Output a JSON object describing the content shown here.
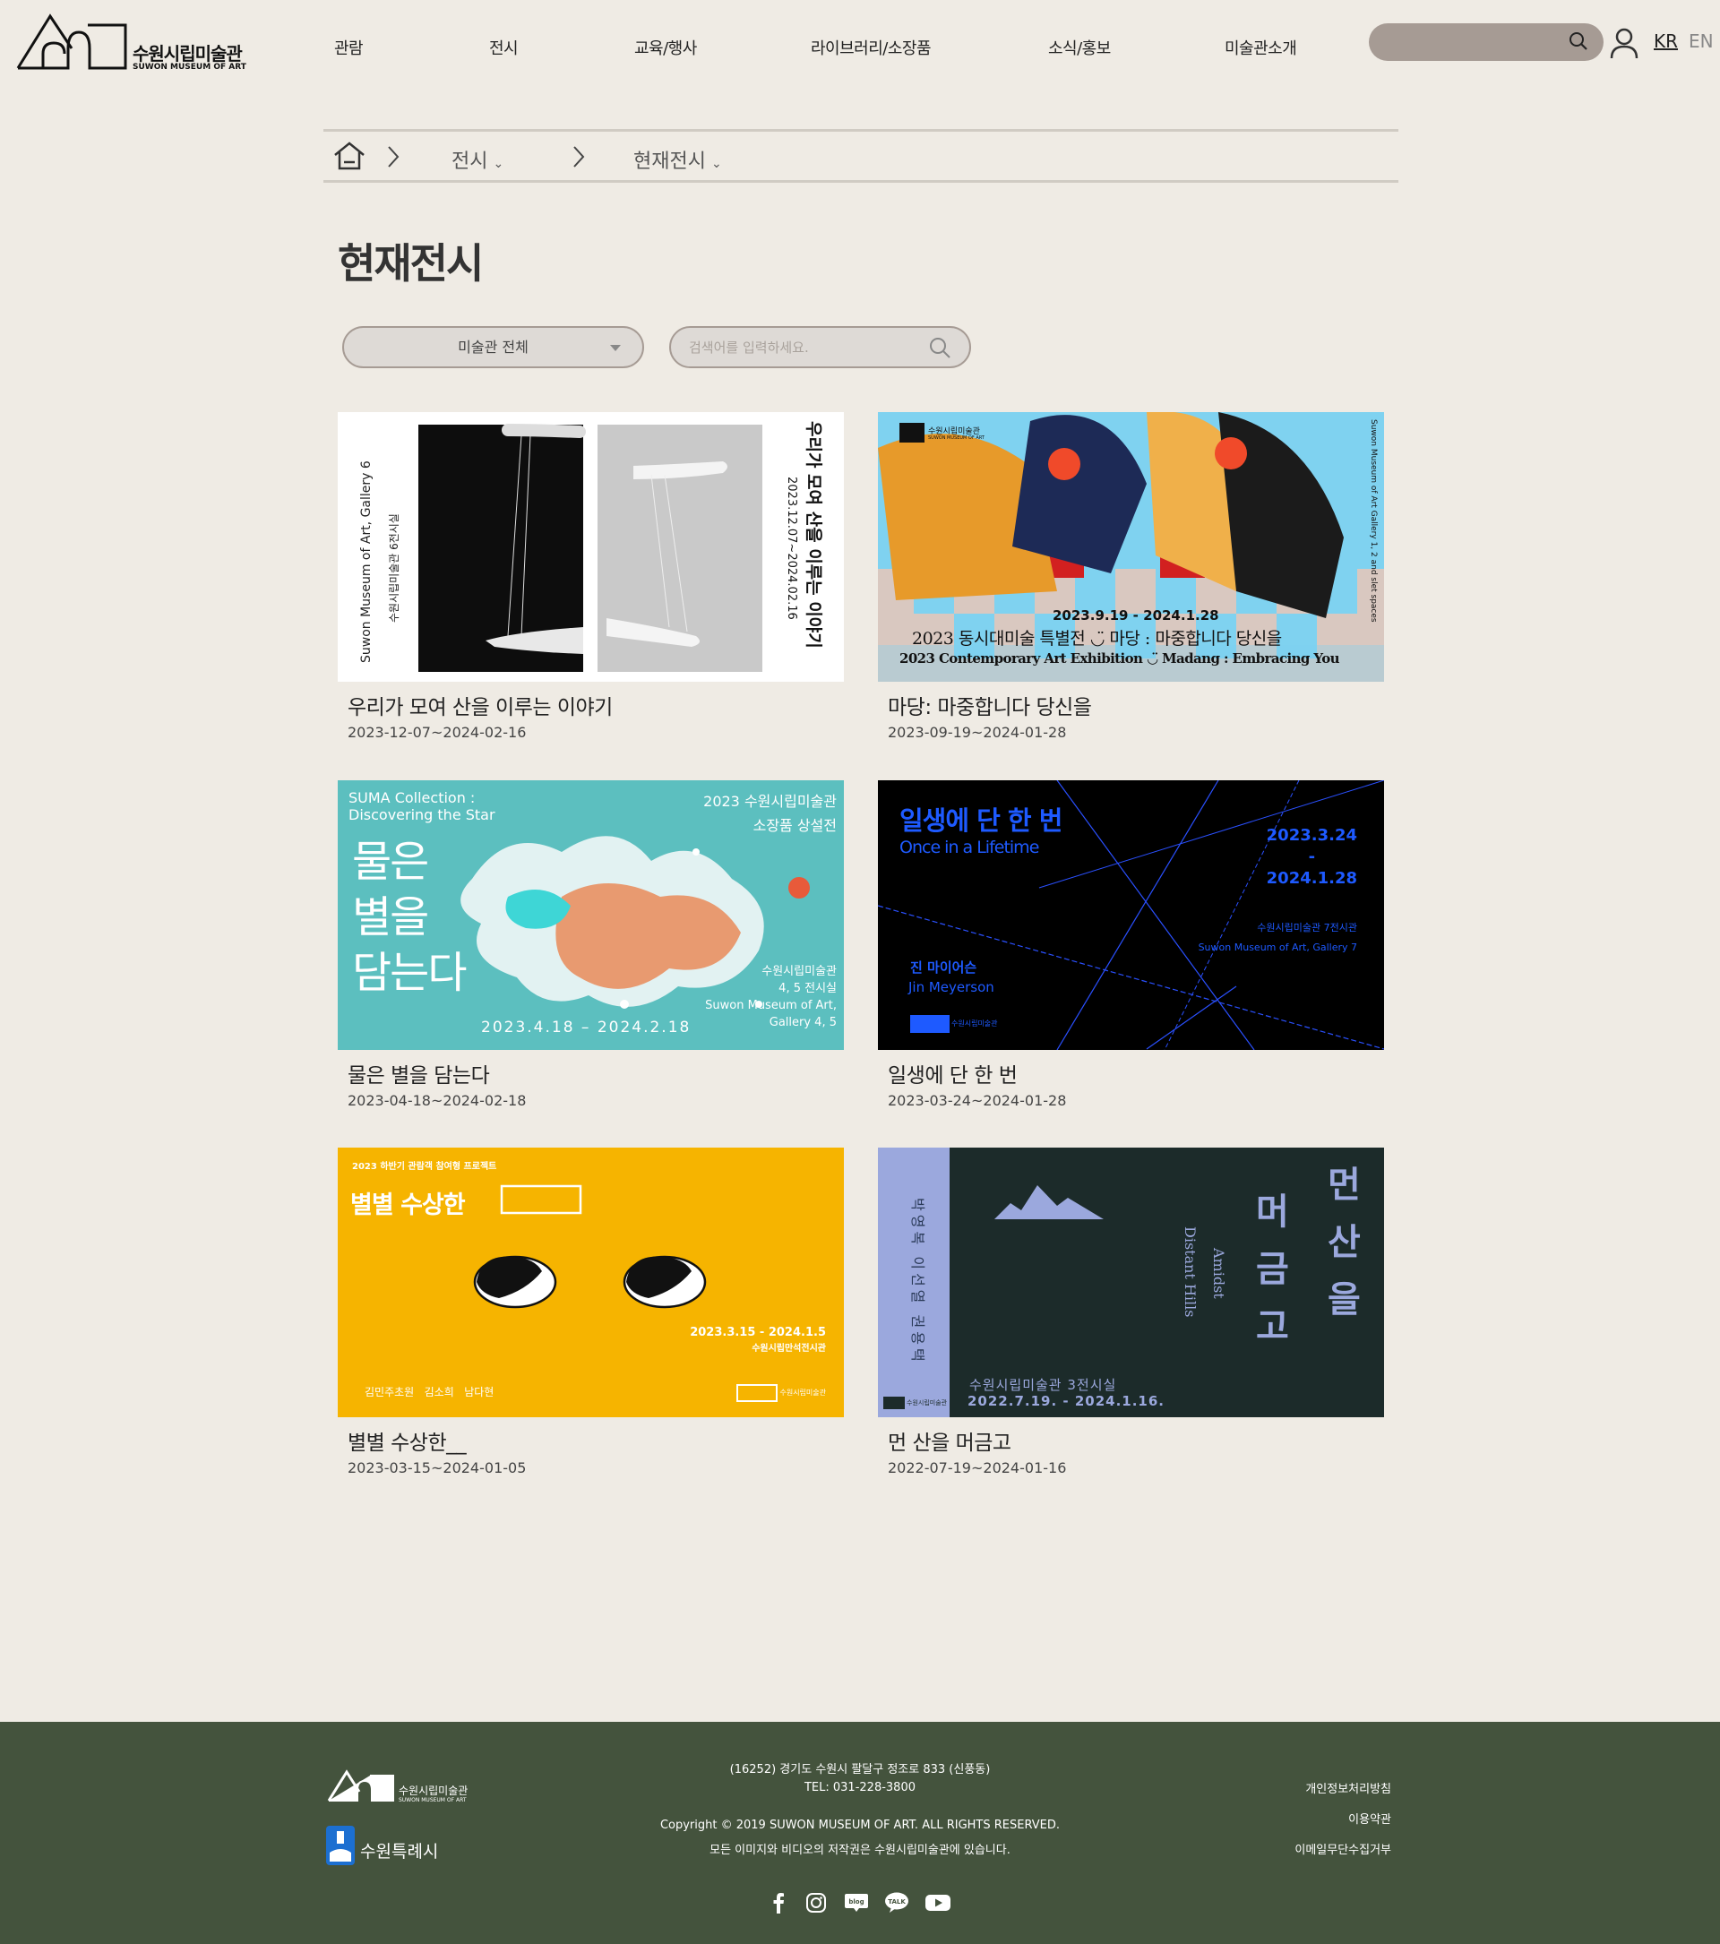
{
  "header": {
    "logo_ko": "수원시립미술관",
    "logo_en": "SUWON MUSEUM OF ART",
    "nav": [
      "관람",
      "전시",
      "교육/행사",
      "라이브러리/소장품",
      "소식/홍보",
      "미술관소개"
    ],
    "lang_kr": "KR",
    "lang_en": "EN"
  },
  "breadcrumb": {
    "level1": "전시",
    "level2": "현재전시"
  },
  "page_title": "현재전시",
  "filter": {
    "select_value": "미술관 전체",
    "search_placeholder": "검색어를 입력하세요."
  },
  "exhibitions": [
    {
      "title": "우리가 모여 산을 이루는 이야기",
      "date": "2023-12-07~2024-02-16",
      "poster": {
        "side_en": "Suwon Museum of Art, Gallery 6",
        "side_ko": "수원시립미술관 6전시실",
        "title_v": "우리가 모여 산을 이루는 이야기",
        "date_v": "2023.12.07~2024.02.16"
      }
    },
    {
      "title": "마당: 마중합니다 당신을",
      "date": "2023-09-19~2024-01-28",
      "poster": {
        "date": "2023.9.19 - 2024.1.28",
        "title_ko": "2023 동시대미술 특별전 ◡̈ 마당 : 마중합니다 당신을",
        "title_en": "2023 Contemporary Art Exhibition ◡̈ Madang : Embracing You",
        "side": "Suwon Museum of Art Gallery 1, 2 and slet spaces",
        "logo_ko": "수원시립미술관",
        "logo_en": "SUWON MUSEUM OF ART"
      }
    },
    {
      "title": "물은 별을 담는다",
      "date": "2023-04-18~2024-02-18",
      "poster": {
        "en1": "SUMA Collection :",
        "en2": "Discovering the Star",
        "kr_top1": "2023 수원시립미술관",
        "kr_top2": "소장품 상설전",
        "big1": "물은",
        "big2": "별을",
        "big3": "담는다",
        "loc1": "수원시립미술관",
        "loc2": "4, 5 전시실",
        "loc3": "Suwon Museum of Art,",
        "loc4": "Gallery 4, 5",
        "dates": "2023.4.18 – 2024.2.18"
      }
    },
    {
      "title": "일생에 단 한 번",
      "date": "2023-03-24~2024-01-28",
      "poster": {
        "title_ko": "일생에 단 한 번",
        "title_en": "Once in a Lifetime",
        "date1": "2023.3.24",
        "dash": "-",
        "date2": "2024.1.28",
        "loc_ko": "수원시립미술관 7전시관",
        "loc_en": "Suwon Museum of Art, Gallery 7",
        "artist_ko": "진 마이어슨",
        "artist_en": "Jin Meyerson",
        "logo_ko": "수원시립미술관"
      }
    },
    {
      "title": "별별 수상한__",
      "date": "2023-03-15~2024-01-05",
      "poster": {
        "top": "2023 하반기 관람객 참여형 프로젝트",
        "title": "별별 수상한",
        "dates": "2023.3.15 - 2024.1.5",
        "venue": "수원시립만석전시관",
        "artists": "김민주초원   김소희   남다현",
        "logo_ko": "수원시립미술관"
      }
    },
    {
      "title": "먼 산을 머금고",
      "date": "2022-07-19~2024-01-16",
      "poster": {
        "artists": "박영복 이선열 권용택",
        "col1": "머금고",
        "col2": "먼산을",
        "en1": "Amidst",
        "en2": "Distant Hills",
        "venue": "수원시립미술관 3전시실",
        "dates": "2022.7.19. - 2024.1.16.",
        "logo_ko": "수원시립미술관"
      }
    }
  ],
  "footer": {
    "logo_ko": "수원시립미술관",
    "logo_en": "SUWON MUSEUM OF ART",
    "suwon": "수원특례시",
    "address": "(16252) 경기도 수원시 팔달구 정조로 833 (신풍동)",
    "tel": "TEL: 031-228-3800",
    "copyright": "Copyright © 2019 SUWON MUSEUM OF ART. ALL RIGHTS RESERVED.",
    "notice": "모든 이미지와 비디오의 저작권은 수원시립미술관에 있습니다.",
    "links": [
      "개인정보처리방침",
      "이용약관",
      "이메일무단수집거부"
    ],
    "sns": [
      "facebook-icon",
      "instagram-icon",
      "blog-icon",
      "kakaotalk-icon",
      "youtube-icon"
    ]
  }
}
